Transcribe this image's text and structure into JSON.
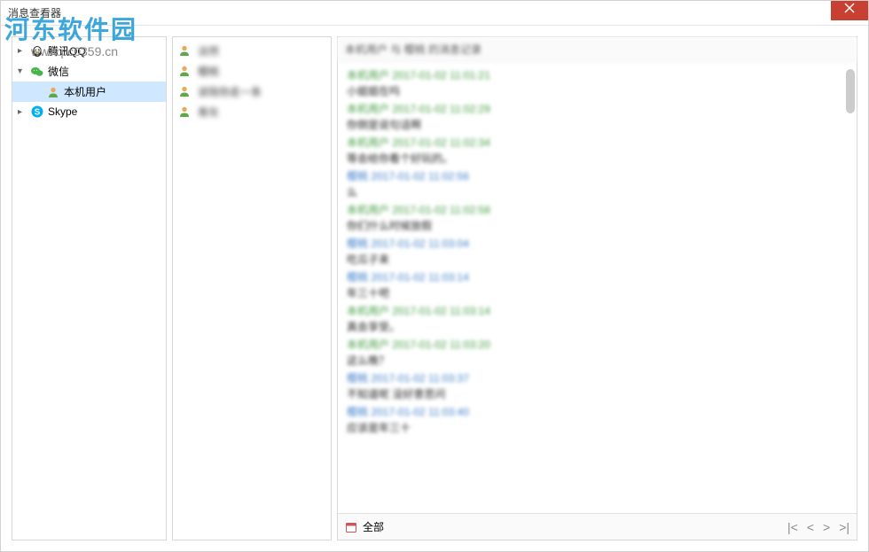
{
  "window": {
    "title": "消息查看器"
  },
  "watermark": {
    "brand": "河东软件园",
    "url": "www.pc0359.cn"
  },
  "tree": {
    "items": [
      {
        "label": "腾讯QQ",
        "icon": "qq",
        "expanded": false,
        "children": []
      },
      {
        "label": "微信",
        "icon": "wechat",
        "expanded": true,
        "children": [
          {
            "label": "本机用户",
            "icon": "user",
            "selected": true
          }
        ]
      },
      {
        "label": "Skype",
        "icon": "skype",
        "expanded": false,
        "children": []
      }
    ]
  },
  "contacts": {
    "items": [
      {
        "label": "淡然"
      },
      {
        "label": "樱桃"
      },
      {
        "label": "该陪你走一条"
      },
      {
        "label": "骨灰"
      }
    ]
  },
  "chat": {
    "header": "本机用户 与 樱桃 的消息记录",
    "messages": [
      {
        "sender": "green",
        "meta": "本机用户 2017-01-02 11:01:21",
        "text": "小姐姐在吗"
      },
      {
        "sender": "green",
        "meta": "本机用户 2017-01-02 11:02:29",
        "text": "你倒是说句话啊"
      },
      {
        "sender": "green",
        "meta": "本机用户 2017-01-02 11:02:34",
        "text": "等会给你看个好玩的。"
      },
      {
        "sender": "blue",
        "meta": "樱桃 2017-01-02 11:02:56",
        "text": "么"
      },
      {
        "sender": "green",
        "meta": "本机用户 2017-01-02 11:02:58",
        "text": "你们什么时候放假"
      },
      {
        "sender": "blue",
        "meta": "樱桃 2017-01-02 11:03:04",
        "text": "吃瓜子来"
      },
      {
        "sender": "blue",
        "meta": "樱桃 2017-01-02 11:03:14",
        "text": "年三十吧"
      },
      {
        "sender": "green",
        "meta": "本机用户 2017-01-02 11:03:14",
        "text": "真会享受。"
      },
      {
        "sender": "green",
        "meta": "本机用户 2017-01-02 11:03:20",
        "text": "这么晚？"
      },
      {
        "sender": "blue",
        "meta": "樱桃 2017-01-02 11:03:37",
        "text": "不知道呢 没好意思问"
      },
      {
        "sender": "blue",
        "meta": "樱桃 2017-01-02 11:03:40",
        "text": "应该是年三十"
      }
    ],
    "footer": {
      "cal_label": "全部",
      "pager": {
        "first": "|<",
        "prev": "<",
        "next": ">",
        "last": ">|"
      }
    }
  }
}
